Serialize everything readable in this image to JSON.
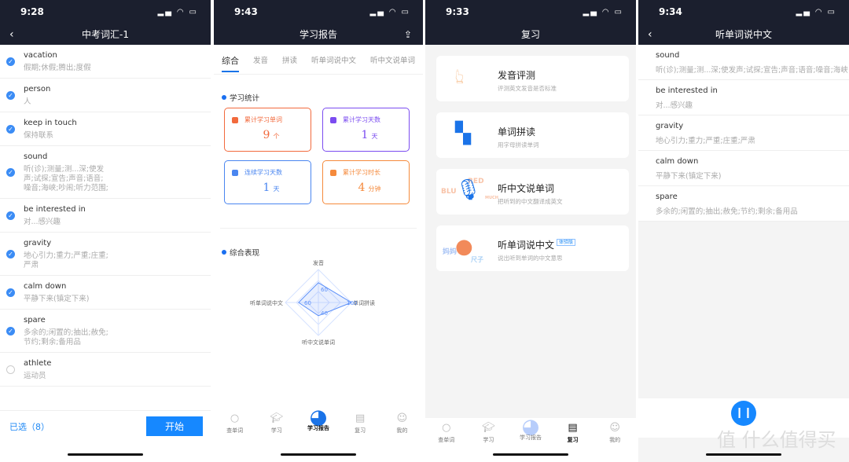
{
  "panel1": {
    "time": "9:28",
    "title": "中考词汇-1",
    "selected_label": "已选（8）",
    "start_label": "开始",
    "words": [
      {
        "word": "vacation",
        "meaning": "假期;休假;腾出;度假",
        "checked": true
      },
      {
        "word": "person",
        "meaning": "人",
        "checked": true
      },
      {
        "word": "keep in touch",
        "meaning": "保持联系",
        "checked": true
      },
      {
        "word": "sound",
        "meaning": "听(诊);测量;测...深;使发声;试探;宣告;声音;语音;噪音;海峡;吵闹;听力范围;",
        "checked": true
      },
      {
        "word": "be interested in",
        "meaning": "对...感兴趣",
        "checked": true
      },
      {
        "word": "gravity",
        "meaning": "地心引力;重力;严重;庄重;严肃",
        "checked": true
      },
      {
        "word": "calm down",
        "meaning": "平静下来(镇定下来)",
        "checked": true
      },
      {
        "word": "spare",
        "meaning": "多余的;闲置的;抽出;赦免;节约;剩余;备用品",
        "checked": true
      },
      {
        "word": "athlete",
        "meaning": "运动员",
        "checked": false
      }
    ]
  },
  "panel2": {
    "time": "9:43",
    "title": "学习报告",
    "tabs": [
      "综合",
      "发音",
      "拼读",
      "听单词说中文",
      "听中文说单词"
    ],
    "stats_title": "学习统计",
    "stats": [
      {
        "label": "累计学习单词",
        "value": "9",
        "unit": "个",
        "color": "#f26a3d"
      },
      {
        "label": "累计学习天数",
        "value": "1",
        "unit": "天",
        "color": "#7b4cf0"
      },
      {
        "label": "连续学习天数",
        "value": "1",
        "unit": "天",
        "color": "#4a86f0"
      },
      {
        "label": "累计学习时长",
        "value": "4",
        "unit": "分钟",
        "color": "#f58a3c"
      }
    ],
    "radar_title": "综合表现"
  },
  "chart_data": {
    "type": "radar",
    "axes": [
      "发音",
      "单词拼读",
      "听中文说单词",
      "听单词说中文"
    ],
    "values": [
      60,
      100,
      40,
      60
    ],
    "max": 100,
    "color": "#5b8ff9"
  },
  "tabbar": [
    {
      "label": "查单词",
      "icon": "search-icon"
    },
    {
      "label": "学习",
      "icon": "graduation-cap-icon"
    },
    {
      "label": "学习报告",
      "icon": "pie-chart-icon"
    },
    {
      "label": "复习",
      "icon": "note-icon"
    },
    {
      "label": "我的",
      "icon": "smiley-icon"
    }
  ],
  "panel3": {
    "time": "9:33",
    "title": "复习",
    "cards": [
      {
        "title": "发音评测",
        "sub": "评测英文发音是否标准",
        "icon": "thumb-tap-icon"
      },
      {
        "title": "单词拼读",
        "sub": "用字母拼读单词",
        "icon": "blocks-icon"
      },
      {
        "title": "听中文说单词",
        "sub": "把听到的中文翻译成英文",
        "icon": "microphone-icon",
        "deco": [
          "BLU",
          "RED",
          "MUCH"
        ]
      },
      {
        "title": "听单词说中文",
        "sub": "说出听到单词的中文意思",
        "icon": "mouth-icon",
        "badge": "体验版",
        "deco": [
          "妈妈",
          "尺子"
        ]
      }
    ]
  },
  "panel4": {
    "time": "9:34",
    "title": "听单词说中文",
    "words": [
      {
        "word": "sound",
        "meaning": "听(诊);测量;测...深;使发声;试探;宣告;声音;语音;噪音;海峡"
      },
      {
        "word": "be interested in",
        "meaning": "对...感兴趣"
      },
      {
        "word": "gravity",
        "meaning": "地心引力;重力;严重;庄重;严肃"
      },
      {
        "word": "calm down",
        "meaning": "平静下来(镇定下来)"
      },
      {
        "word": "spare",
        "meaning": "多余的;闲置的;抽出;赦免;节约;剩余;备用品"
      }
    ],
    "watermark": "值 什么值得买"
  },
  "colors": {
    "dark": "#1b1f2e",
    "accent": "#1688ff"
  }
}
